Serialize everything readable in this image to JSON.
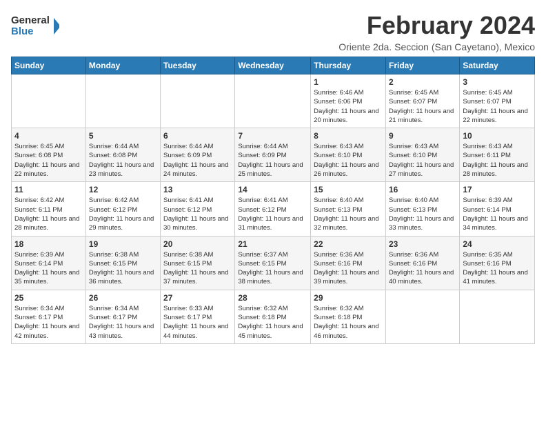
{
  "logo": {
    "line1": "General",
    "line2": "Blue"
  },
  "title": "February 2024",
  "location": "Oriente 2da. Seccion (San Cayetano), Mexico",
  "days_header": [
    "Sunday",
    "Monday",
    "Tuesday",
    "Wednesday",
    "Thursday",
    "Friday",
    "Saturday"
  ],
  "weeks": [
    [
      {
        "day": "",
        "info": ""
      },
      {
        "day": "",
        "info": ""
      },
      {
        "day": "",
        "info": ""
      },
      {
        "day": "",
        "info": ""
      },
      {
        "day": "1",
        "info": "Sunrise: 6:46 AM\nSunset: 6:06 PM\nDaylight: 11 hours and 20 minutes."
      },
      {
        "day": "2",
        "info": "Sunrise: 6:45 AM\nSunset: 6:07 PM\nDaylight: 11 hours and 21 minutes."
      },
      {
        "day": "3",
        "info": "Sunrise: 6:45 AM\nSunset: 6:07 PM\nDaylight: 11 hours and 22 minutes."
      }
    ],
    [
      {
        "day": "4",
        "info": "Sunrise: 6:45 AM\nSunset: 6:08 PM\nDaylight: 11 hours and 22 minutes."
      },
      {
        "day": "5",
        "info": "Sunrise: 6:44 AM\nSunset: 6:08 PM\nDaylight: 11 hours and 23 minutes."
      },
      {
        "day": "6",
        "info": "Sunrise: 6:44 AM\nSunset: 6:09 PM\nDaylight: 11 hours and 24 minutes."
      },
      {
        "day": "7",
        "info": "Sunrise: 6:44 AM\nSunset: 6:09 PM\nDaylight: 11 hours and 25 minutes."
      },
      {
        "day": "8",
        "info": "Sunrise: 6:43 AM\nSunset: 6:10 PM\nDaylight: 11 hours and 26 minutes."
      },
      {
        "day": "9",
        "info": "Sunrise: 6:43 AM\nSunset: 6:10 PM\nDaylight: 11 hours and 27 minutes."
      },
      {
        "day": "10",
        "info": "Sunrise: 6:43 AM\nSunset: 6:11 PM\nDaylight: 11 hours and 28 minutes."
      }
    ],
    [
      {
        "day": "11",
        "info": "Sunrise: 6:42 AM\nSunset: 6:11 PM\nDaylight: 11 hours and 28 minutes."
      },
      {
        "day": "12",
        "info": "Sunrise: 6:42 AM\nSunset: 6:12 PM\nDaylight: 11 hours and 29 minutes."
      },
      {
        "day": "13",
        "info": "Sunrise: 6:41 AM\nSunset: 6:12 PM\nDaylight: 11 hours and 30 minutes."
      },
      {
        "day": "14",
        "info": "Sunrise: 6:41 AM\nSunset: 6:12 PM\nDaylight: 11 hours and 31 minutes."
      },
      {
        "day": "15",
        "info": "Sunrise: 6:40 AM\nSunset: 6:13 PM\nDaylight: 11 hours and 32 minutes."
      },
      {
        "day": "16",
        "info": "Sunrise: 6:40 AM\nSunset: 6:13 PM\nDaylight: 11 hours and 33 minutes."
      },
      {
        "day": "17",
        "info": "Sunrise: 6:39 AM\nSunset: 6:14 PM\nDaylight: 11 hours and 34 minutes."
      }
    ],
    [
      {
        "day": "18",
        "info": "Sunrise: 6:39 AM\nSunset: 6:14 PM\nDaylight: 11 hours and 35 minutes."
      },
      {
        "day": "19",
        "info": "Sunrise: 6:38 AM\nSunset: 6:15 PM\nDaylight: 11 hours and 36 minutes."
      },
      {
        "day": "20",
        "info": "Sunrise: 6:38 AM\nSunset: 6:15 PM\nDaylight: 11 hours and 37 minutes."
      },
      {
        "day": "21",
        "info": "Sunrise: 6:37 AM\nSunset: 6:15 PM\nDaylight: 11 hours and 38 minutes."
      },
      {
        "day": "22",
        "info": "Sunrise: 6:36 AM\nSunset: 6:16 PM\nDaylight: 11 hours and 39 minutes."
      },
      {
        "day": "23",
        "info": "Sunrise: 6:36 AM\nSunset: 6:16 PM\nDaylight: 11 hours and 40 minutes."
      },
      {
        "day": "24",
        "info": "Sunrise: 6:35 AM\nSunset: 6:16 PM\nDaylight: 11 hours and 41 minutes."
      }
    ],
    [
      {
        "day": "25",
        "info": "Sunrise: 6:34 AM\nSunset: 6:17 PM\nDaylight: 11 hours and 42 minutes."
      },
      {
        "day": "26",
        "info": "Sunrise: 6:34 AM\nSunset: 6:17 PM\nDaylight: 11 hours and 43 minutes."
      },
      {
        "day": "27",
        "info": "Sunrise: 6:33 AM\nSunset: 6:17 PM\nDaylight: 11 hours and 44 minutes."
      },
      {
        "day": "28",
        "info": "Sunrise: 6:32 AM\nSunset: 6:18 PM\nDaylight: 11 hours and 45 minutes."
      },
      {
        "day": "29",
        "info": "Sunrise: 6:32 AM\nSunset: 6:18 PM\nDaylight: 11 hours and 46 minutes."
      },
      {
        "day": "",
        "info": ""
      },
      {
        "day": "",
        "info": ""
      }
    ]
  ]
}
